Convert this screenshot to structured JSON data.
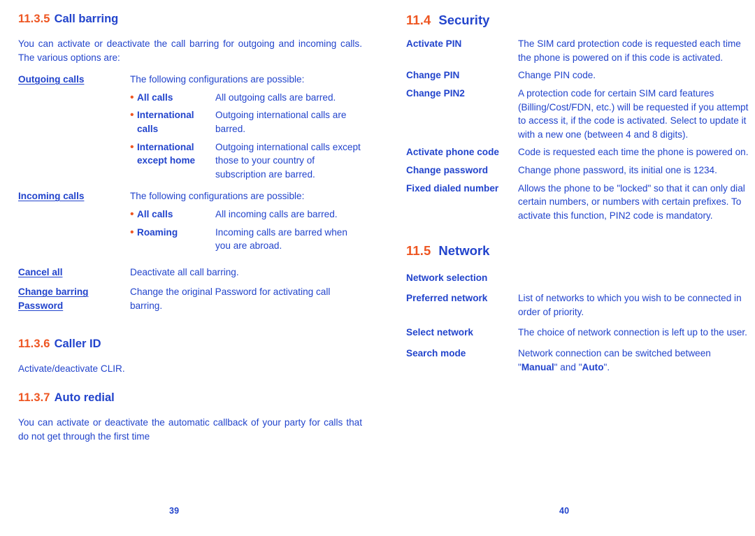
{
  "colors": {
    "heading_number": "#ee5622",
    "heading_title": "#2244cc",
    "body_text": "#2244cc",
    "bullet": "#ee5622",
    "page_background": "#ffffff"
  },
  "left_page": {
    "page_number": "39",
    "sections": [
      {
        "number": "11.3.5",
        "title": "Call barring",
        "intro": "You can activate or deactivate the call barring for outgoing and incoming calls. The various options are:",
        "rows": [
          {
            "term": "Outgoing calls",
            "underline": true,
            "desc": "The following configurations are possible:",
            "subrows": [
              {
                "bullet": "•",
                "term": "All calls",
                "desc": "All outgoing calls are barred."
              },
              {
                "bullet": "•",
                "term": "International calls",
                "desc": "Outgoing international calls are barred."
              },
              {
                "bullet": "•",
                "term": "International except home",
                "desc": "Outgoing international calls except those to your country of subscription are barred."
              }
            ]
          },
          {
            "term": "Incoming calls",
            "underline": true,
            "desc": "The following configurations are possible:",
            "subrows": [
              {
                "bullet": "•",
                "term": "All calls",
                "desc": "All incoming calls are barred."
              },
              {
                "bullet": "•",
                "term": "Roaming",
                "desc": "Incoming calls are barred when you are abroad."
              }
            ]
          },
          {
            "term": "Cancel all",
            "underline": true,
            "desc": "Deactivate all call barring.",
            "subrows": []
          },
          {
            "term": "Change barring Password",
            "underline": true,
            "desc": "Change the original Password for activating call barring.",
            "subrows": []
          }
        ]
      },
      {
        "number": "11.3.6",
        "title": "Caller ID",
        "intro": "Activate/deactivate CLIR.",
        "rows": []
      },
      {
        "number": "11.3.7",
        "title": "Auto redial",
        "intro": "You can activate or deactivate the automatic callback of your party for calls that do not get through the first time",
        "rows": []
      }
    ]
  },
  "right_page": {
    "page_number": "40",
    "sections": [
      {
        "number": "11.4",
        "title": "Security",
        "rows": [
          {
            "term": "Activate PIN",
            "desc": "The SIM card protection code is requested each time the phone is powered on if this code is activated."
          },
          {
            "term": "Change PIN",
            "desc": "Change PIN code."
          },
          {
            "term": "Change PIN2",
            "desc": "A protection code for certain SIM card features (Billing/Cost/FDN, etc.) will be requested if you attempt to access it, if the code is activated. Select to update it with a new one (between 4 and 8 digits)."
          },
          {
            "term": "Activate phone code",
            "desc": "Code is requested each time the phone is powered on."
          },
          {
            "term": "Change password",
            "desc": "Change phone password, its initial one is 1234."
          },
          {
            "term": "Fixed dialed number",
            "desc": "Allows the phone to be \"locked\" so that it can only dial certain numbers, or numbers with certain prefixes. To activate this function, PIN2 code is mandatory."
          }
        ]
      },
      {
        "number": "11.5",
        "title": "Network",
        "rows": [
          {
            "term": "Network selection",
            "desc": ""
          },
          {
            "term": "Preferred network",
            "desc": "List of networks to which you wish to be connected in order of priority."
          },
          {
            "term": "Select network",
            "desc": "The choice of network connection is left up to the user."
          },
          {
            "term": "Search mode",
            "desc_html": "Network connection can be switched between \"<b>Manual</b>\" and \"<b>Auto</b>\"."
          }
        ]
      }
    ]
  }
}
